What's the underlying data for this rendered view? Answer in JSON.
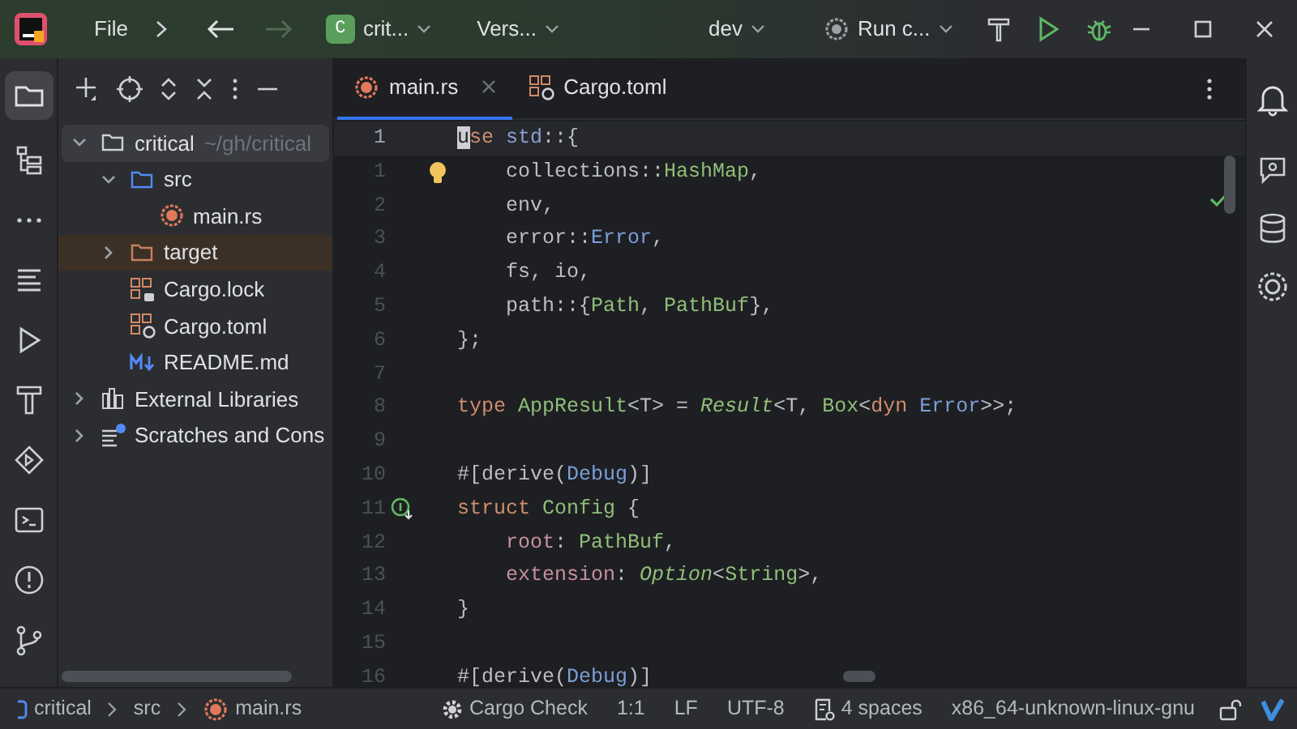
{
  "title_bar": {
    "menu": "File",
    "project_badge": "C",
    "project": "crit...",
    "vcs": "Vers...",
    "branch": "dev",
    "run_config": "Run c..."
  },
  "project_tree": [
    {
      "label": "critical",
      "hint": "~/gh/critical",
      "kind": "folder",
      "expanded": true,
      "selected": true,
      "children": [
        {
          "label": "src",
          "kind": "source-folder",
          "expanded": true,
          "selected": false,
          "children": [
            {
              "label": "main.rs",
              "kind": "rust-file",
              "selected": false
            }
          ]
        },
        {
          "label": "target",
          "kind": "excluded-folder",
          "expanded": false,
          "selected": false
        },
        {
          "label": "Cargo.lock",
          "kind": "cargo-lock",
          "selected": false
        },
        {
          "label": "Cargo.toml",
          "kind": "cargo-file",
          "selected": false
        },
        {
          "label": "README.md",
          "kind": "markdown-file",
          "selected": false
        }
      ]
    },
    {
      "label": "External Libraries",
      "kind": "libraries",
      "expanded": false,
      "selected": false
    },
    {
      "label": "Scratches and Cons",
      "kind": "scratches",
      "expanded": false,
      "selected": false
    }
  ],
  "tabs": [
    {
      "label": "main.rs",
      "kind": "rust-file",
      "selected": true
    },
    {
      "label": "Cargo.toml",
      "kind": "cargo-file",
      "selected": false
    }
  ],
  "editor": {
    "lines": [
      {
        "number": "1",
        "current": true,
        "indented": false,
        "tokens": [
          {
            "text": "use ",
            "kind": "keyword"
          },
          {
            "text": "std",
            "kind": "crate"
          },
          {
            "text": "::{"
          }
        ]
      },
      {
        "number": "1",
        "current": false,
        "indented": true,
        "lightbulb": true,
        "tokens": [
          {
            "text": "collections::"
          },
          {
            "text": "HashMap",
            "kind": "type"
          },
          {
            "text": ","
          }
        ]
      },
      {
        "number": "2",
        "current": false,
        "indented": true,
        "tokens": [
          {
            "text": "env,"
          }
        ]
      },
      {
        "number": "3",
        "current": false,
        "indented": true,
        "tokens": [
          {
            "text": "error::"
          },
          {
            "text": "Error",
            "kind": "trait"
          },
          {
            "text": ","
          }
        ]
      },
      {
        "number": "4",
        "current": false,
        "indented": true,
        "tokens": [
          {
            "text": "fs, io,"
          }
        ]
      },
      {
        "number": "5",
        "current": false,
        "indented": true,
        "tokens": [
          {
            "text": "path::{"
          },
          {
            "text": "Path",
            "kind": "type"
          },
          {
            "text": ", "
          },
          {
            "text": "PathBuf",
            "kind": "type"
          },
          {
            "text": "},"
          }
        ]
      },
      {
        "number": "6",
        "current": false,
        "indented": false,
        "tokens": [
          {
            "text": "};"
          }
        ]
      },
      {
        "number": "7",
        "current": false
      },
      {
        "number": "8",
        "current": false,
        "indented": false,
        "tokens": [
          {
            "text": "type ",
            "kind": "keyword"
          },
          {
            "text": "AppResult",
            "kind": "type"
          },
          {
            "text": "<T> = "
          },
          {
            "text": "Result",
            "kind": "italic"
          },
          {
            "text": "<T, "
          },
          {
            "text": "Box",
            "kind": "type"
          },
          {
            "text": "<"
          },
          {
            "text": "dyn ",
            "kind": "keyword"
          },
          {
            "text": "Error",
            "kind": "trait"
          },
          {
            "text": ">>;"
          }
        ]
      },
      {
        "number": "9",
        "current": false
      },
      {
        "number": "10",
        "current": false,
        "indented": false,
        "tokens": [
          {
            "text": "#[derive("
          },
          {
            "text": "Debug",
            "kind": "trait"
          },
          {
            "text": ")]"
          }
        ]
      },
      {
        "number": "11",
        "current": false,
        "indented": false,
        "implemented_marker": true,
        "tokens": [
          {
            "text": "struct ",
            "kind": "keyword"
          },
          {
            "text": "Config",
            "kind": "type"
          },
          {
            "text": " {"
          }
        ]
      },
      {
        "number": "12",
        "current": false,
        "indented": true,
        "tokens": [
          {
            "text": "root",
            "kind": "field"
          },
          {
            "text": ": "
          },
          {
            "text": "PathBuf",
            "kind": "type"
          },
          {
            "text": ","
          }
        ]
      },
      {
        "number": "13",
        "current": false,
        "indented": true,
        "tokens": [
          {
            "text": "extension",
            "kind": "field"
          },
          {
            "text": ": "
          },
          {
            "text": "Option",
            "kind": "italic"
          },
          {
            "text": "<"
          },
          {
            "text": "String",
            "kind": "type"
          },
          {
            "text": ">,"
          }
        ]
      },
      {
        "number": "14",
        "current": false,
        "indented": false,
        "tokens": [
          {
            "text": "}"
          }
        ]
      },
      {
        "number": "15",
        "current": false
      },
      {
        "number": "16",
        "current": false,
        "indented": false,
        "tokens": [
          {
            "text": "#[derive("
          },
          {
            "text": "Debug",
            "kind": "trait"
          },
          {
            "text": ")]"
          }
        ]
      }
    ]
  },
  "status_bar": {
    "breadcrumbs": [
      {
        "label": "critical",
        "kind": "module"
      },
      {
        "label": "src",
        "kind": "plain"
      },
      {
        "label": "main.rs",
        "kind": "rust-file"
      }
    ],
    "cargo_check": "Cargo Check",
    "position": "1:1",
    "line_ending": "LF",
    "encoding": "UTF-8",
    "indent": "4 spaces",
    "toolchain": "x86_64-unknown-linux-gnu"
  }
}
